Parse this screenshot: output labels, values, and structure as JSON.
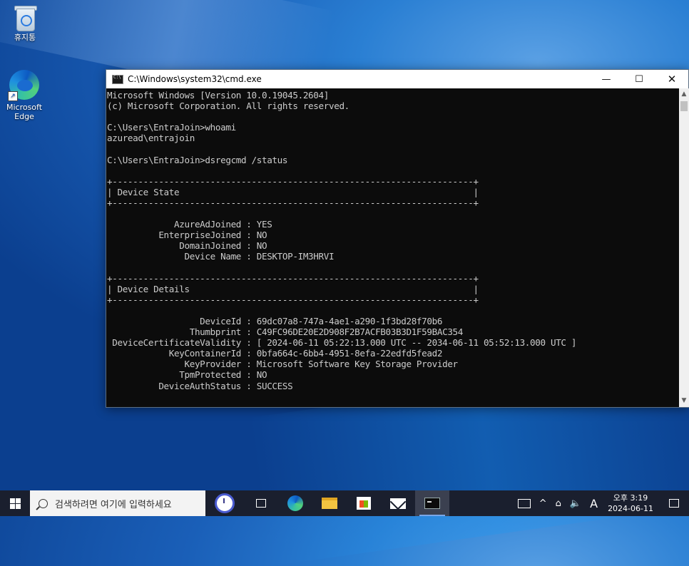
{
  "desktop": {
    "icons": [
      {
        "label": "휴지통"
      },
      {
        "label": "Microsoft Edge"
      }
    ]
  },
  "window": {
    "title": "C:\\Windows\\system32\\cmd.exe",
    "minimize_glyph": "—",
    "maximize_glyph": "☐",
    "close_glyph": "✕"
  },
  "console": {
    "lines": [
      "Microsoft Windows [Version 10.0.19045.2604]",
      "(c) Microsoft Corporation. All rights reserved.",
      "",
      "C:\\Users\\EntraJoin>whoami",
      "azuread\\entrajoin",
      "",
      "C:\\Users\\EntraJoin>dsregcmd /status",
      "",
      "+----------------------------------------------------------------------+",
      "| Device State                                                         |",
      "+----------------------------------------------------------------------+",
      "",
      "             AzureAdJoined : YES",
      "          EnterpriseJoined : NO",
      "              DomainJoined : NO",
      "               Device Name : DESKTOP-IM3HRVI",
      "",
      "+----------------------------------------------------------------------+",
      "| Device Details                                                       |",
      "+----------------------------------------------------------------------+",
      "",
      "                  DeviceId : 69dc07a8-747a-4ae1-a290-1f3bd28f70b6",
      "                Thumbprint : C49FC96DE20E2D908F2B7ACFB03B3D1F59BAC354",
      " DeviceCertificateValidity : [ 2024-06-11 05:22:13.000 UTC -- 2034-06-11 05:52:13.000 UTC ]",
      "            KeyContainerId : 0bfa664c-6bb4-4951-8efa-22edfd5fead2",
      "               KeyProvider : Microsoft Software Key Storage Provider",
      "              TpmProtected : NO",
      "          DeviceAuthStatus : SUCCESS"
    ]
  },
  "taskbar": {
    "search_placeholder": "검색하려면 여기에 입력하세요",
    "apps": [
      "task-view",
      "edge",
      "file-explorer",
      "store",
      "mail",
      "cmd"
    ],
    "tray": {
      "chevron": "^",
      "ime": "A",
      "time": "오후 3:19",
      "date": "2024-06-11"
    }
  }
}
